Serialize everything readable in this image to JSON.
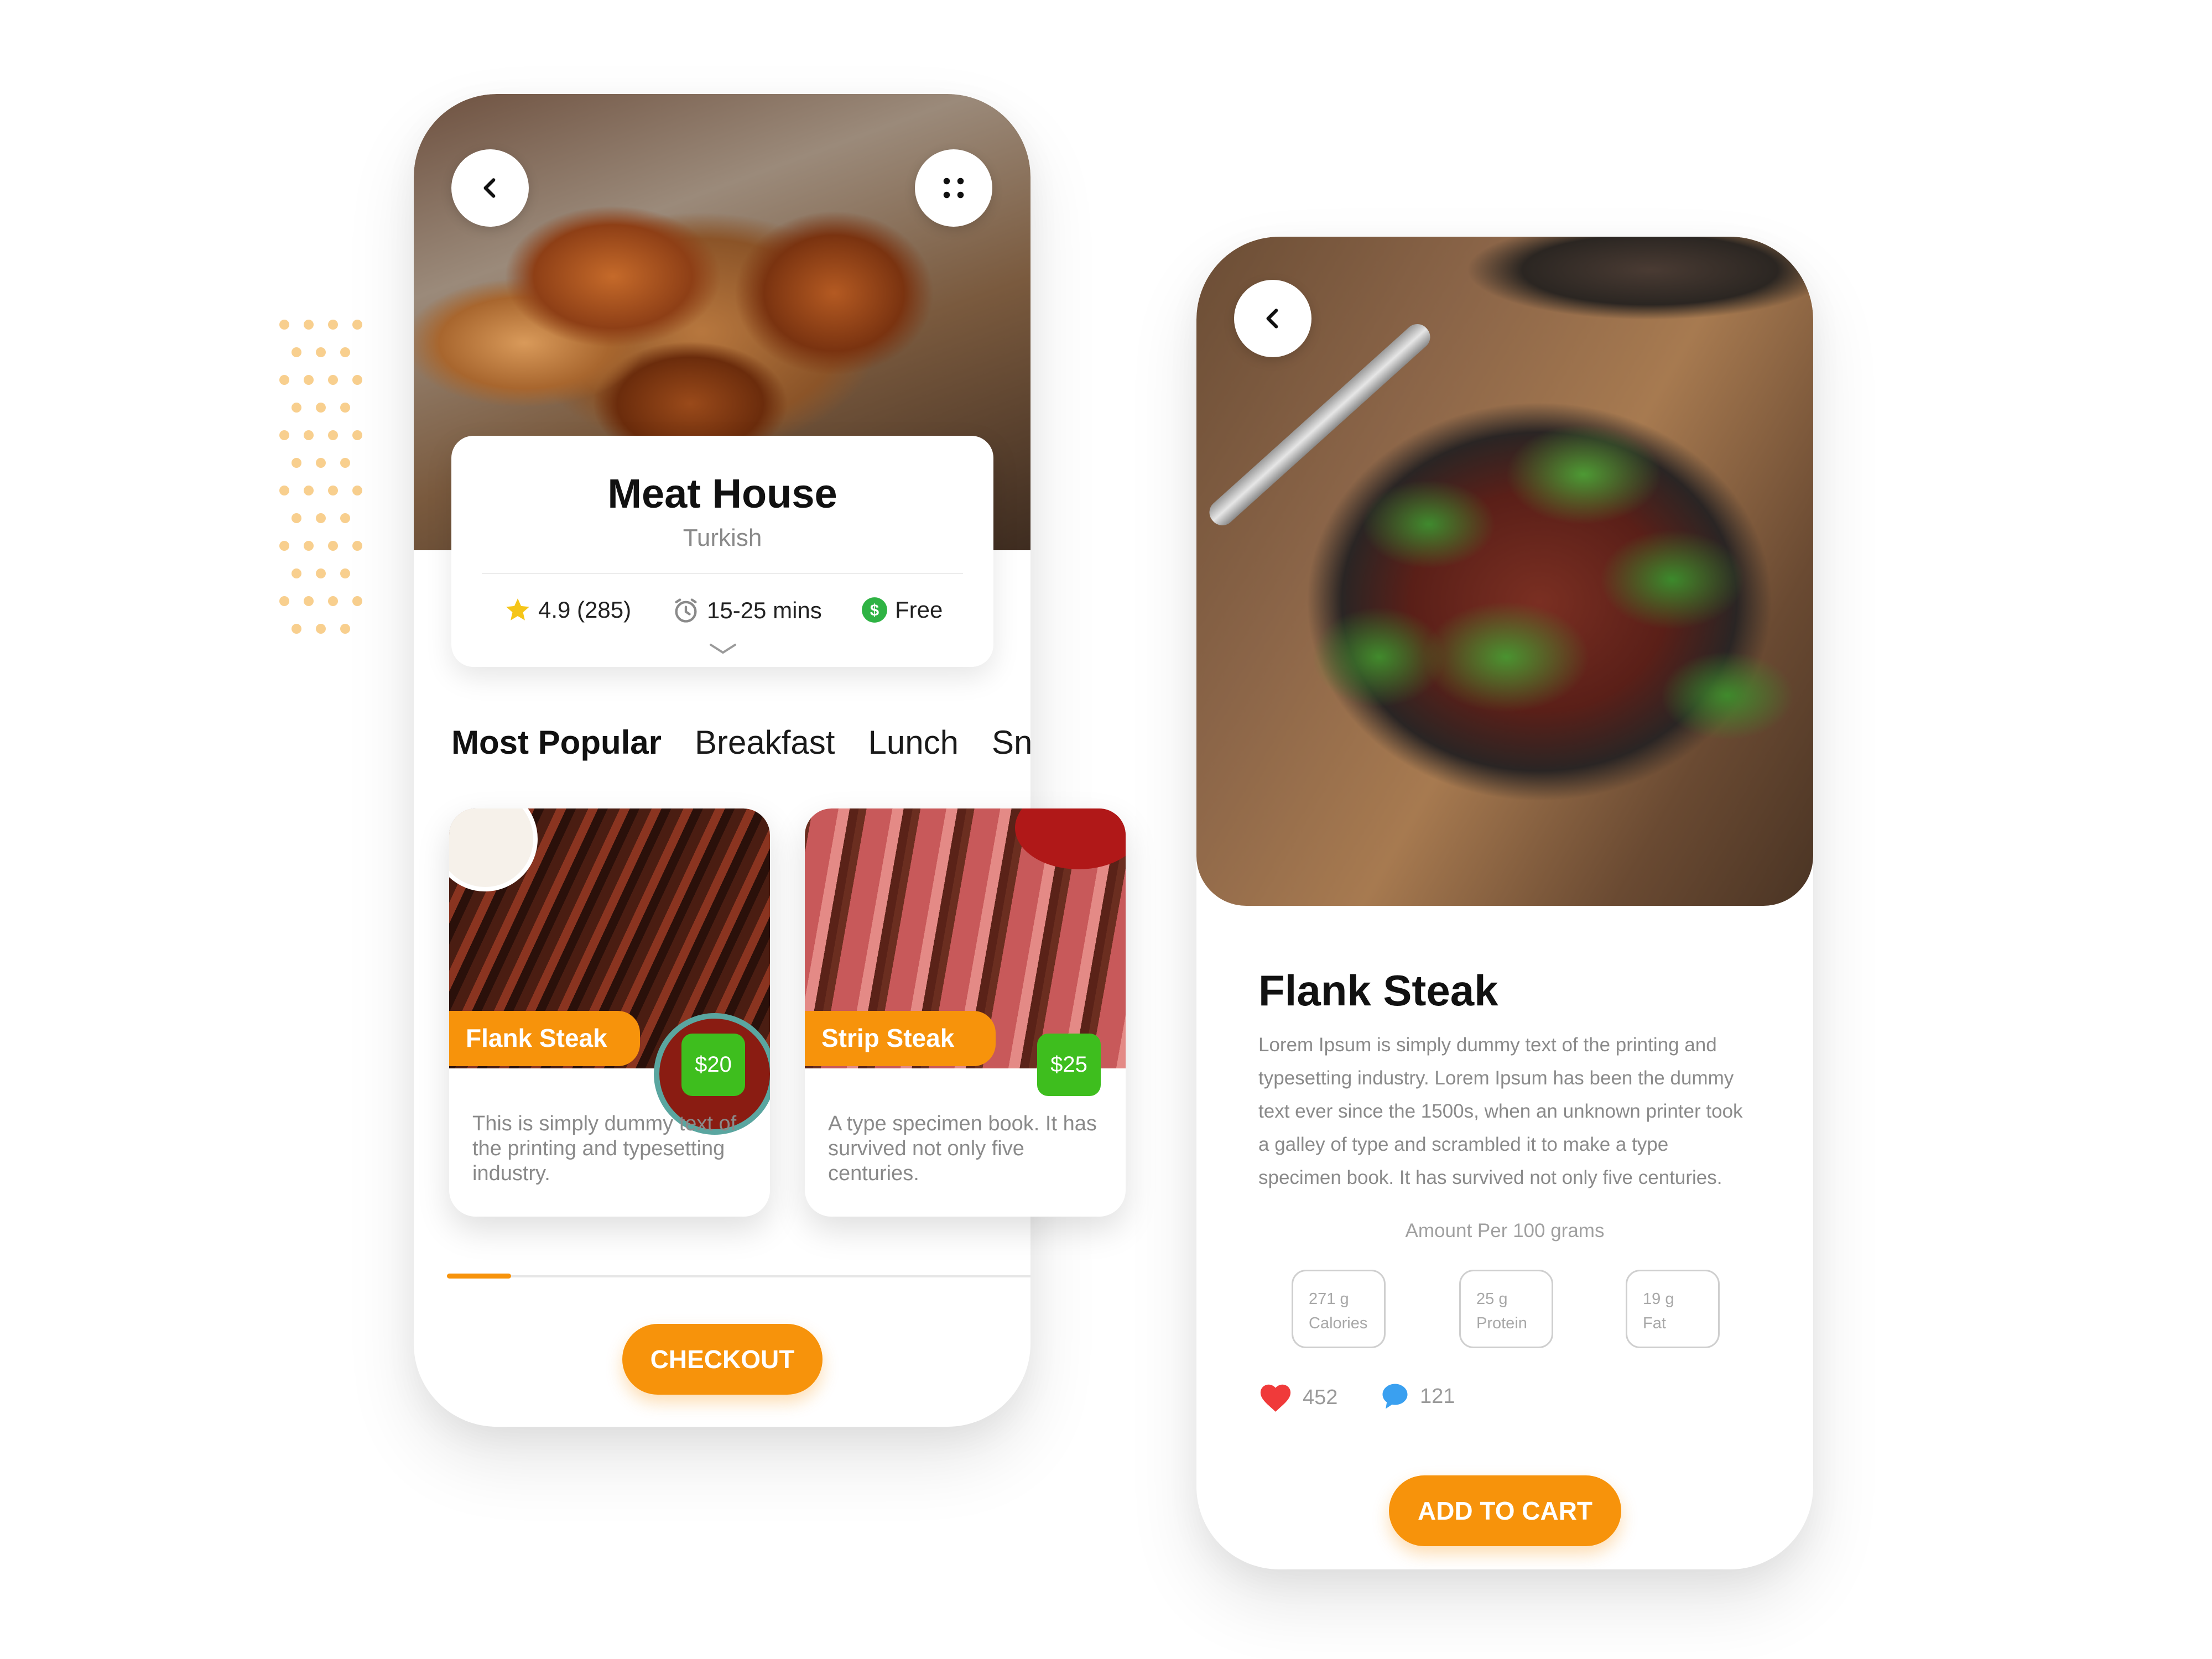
{
  "restaurant": {
    "name": "Meat House",
    "cuisine": "Turkish",
    "rating": "4.9 (285)",
    "delivery_time": "15-25 mins",
    "delivery_fee": "Free"
  },
  "tabs": [
    "Most Popular",
    "Breakfast",
    "Lunch",
    "Sna"
  ],
  "active_tab": "Most Popular",
  "menu_items": [
    {
      "name": "Flank Steak",
      "price": "$20",
      "description": "This is simply dummy text of the printing and typesetting industry."
    },
    {
      "name": "Strip Steak",
      "price": "$25",
      "description": "A type specimen book. It has survived not only five centuries."
    }
  ],
  "checkout_label": "CHECKOUT",
  "detail": {
    "title": "Flank Steak",
    "description": "Lorem Ipsum is simply dummy text of the printing and typesetting industry. Lorem Ipsum has been the dummy text ever since the 1500s, when an unknown printer took a galley of type and scrambled it to make a type specimen book. It has survived not only five centuries.",
    "amount_label": "Amount Per 100 grams",
    "nutrition": [
      {
        "value": "271 g",
        "label": "Calories"
      },
      {
        "value": "25 g",
        "label": "Protein"
      },
      {
        "value": "19 g",
        "label": "Fat"
      }
    ],
    "likes": "452",
    "comments": "121",
    "add_to_cart_label": "ADD TO CART"
  },
  "scroll_progress": 0.11,
  "colors": {
    "accent": "#f7930b",
    "price_badge": "#3ebe1e",
    "heart": "#f03a3a",
    "comment": "#3aa0f0",
    "star": "#f5c518",
    "dots": "#f8cf8e"
  },
  "icons": [
    "back-arrow-icon",
    "grid-menu-icon",
    "star-icon",
    "clock-icon",
    "dollar-icon",
    "chevron-down-icon",
    "heart-icon",
    "comment-icon"
  ]
}
